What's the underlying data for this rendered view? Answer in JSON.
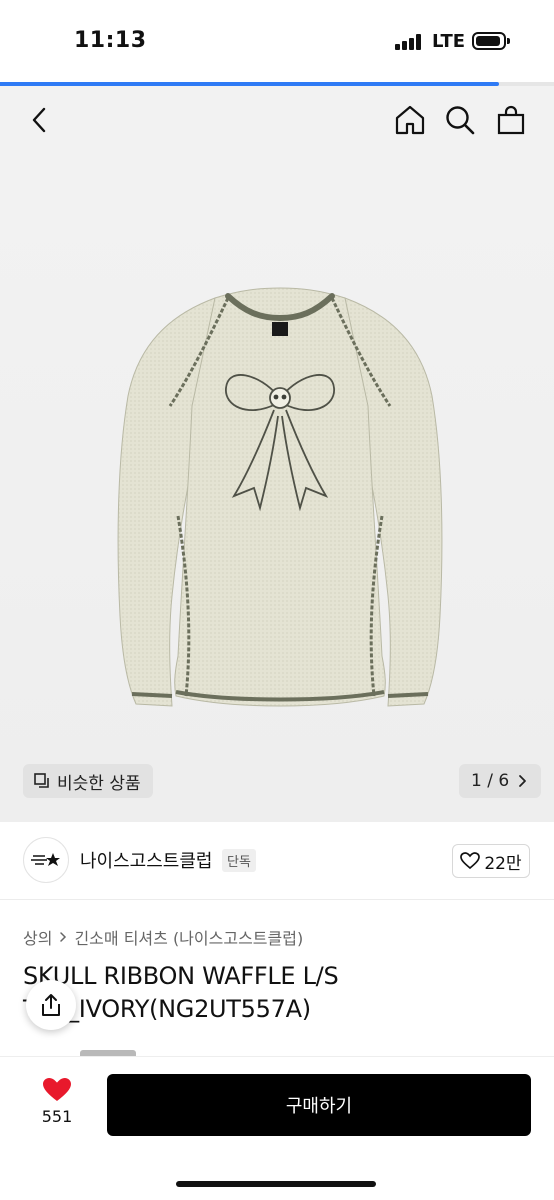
{
  "status_bar": {
    "time": "11:13",
    "carrier": "LTE"
  },
  "page_progress": 0.9,
  "gallery": {
    "similar_label": "비슷한 상품",
    "counter": "1 / 6"
  },
  "brand": {
    "name": "나이스고스트클럽",
    "tag": "단독",
    "like_count": "22만"
  },
  "breadcrumb": {
    "category": "상의",
    "subcategory": "긴소매 티셔츠 (나이스고스트클럽)"
  },
  "product": {
    "title": "SKULL RIBBON WAFFLE L/S TEE_IVORY(NG2UT557A)"
  },
  "bottom_bar": {
    "like_count": "551",
    "buy_label": "구매하기"
  },
  "colors": {
    "accent": "#2f7bf5",
    "heart": "#e8192c",
    "sweater": "#e4e3d3",
    "stitch": "#6b6f5c"
  },
  "icons": [
    "back-icon",
    "home-icon",
    "search-icon",
    "bag-icon",
    "copy-icon",
    "chevron-right-icon",
    "heart-outline-icon",
    "share-icon",
    "heart-filled-icon"
  ]
}
